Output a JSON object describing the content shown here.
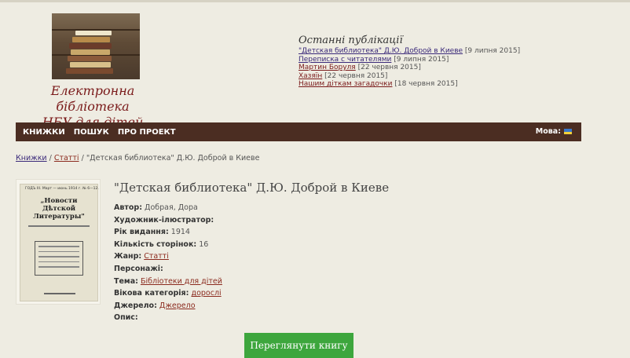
{
  "site": {
    "title_line1": "Електронна бібліотека",
    "title_line2": "НБУ для дітей"
  },
  "recent": {
    "title": "Останні публікації",
    "items": [
      {
        "link": "\"Детская библиотека\" Д.Ю. Доброй в Киеве",
        "date": "[9 липня 2015]"
      },
      {
        "link": "Переписка с читателями",
        "date": "[9 липня 2015]"
      },
      {
        "link": "Мартин Боруля",
        "date": "[22 червня 2015]"
      },
      {
        "link": "Хазяїн",
        "date": "[22 червня 2015]"
      },
      {
        "link": "Нашим діткам загадочки",
        "date": "[18 червня 2015]"
      }
    ]
  },
  "nav": {
    "items": [
      "КНИЖКИ",
      "ПОШУК",
      "ПРО ПРОЕКТ"
    ],
    "lang_label": "Мова:"
  },
  "breadcrumb": {
    "home": "Книжки",
    "sep1": " / ",
    "section": "Статті",
    "sep2": " / ",
    "current": "\"Детская библиотека\" Д.Ю. Доброй в Киеве"
  },
  "cover": {
    "header": "ГОДЪ III.   Март — июнь 1914 г.   № 6—12.",
    "title": "„Новости Дѣтской Литературы\""
  },
  "book": {
    "title": "\"Детская библиотека\" Д.Ю. Доброй в Киеве",
    "fields": [
      {
        "label": "Автор:",
        "value": "Добрая, Дора",
        "link": false
      },
      {
        "label": "Художник-ілюстратор:",
        "value": "",
        "link": false
      },
      {
        "label": "Рік видання:",
        "value": "1914",
        "link": false
      },
      {
        "label": "Кількість сторінок:",
        "value": "16",
        "link": false
      },
      {
        "label": "Жанр:",
        "value": "Статті",
        "link": true
      },
      {
        "label": "Персонажі:",
        "value": "",
        "link": false
      },
      {
        "label": "Тема:",
        "value": "Бібліотеки для дітей",
        "link": true
      },
      {
        "label": "Вікова категорія:",
        "value": "дорослі",
        "link": true
      },
      {
        "label": "Джерело:",
        "value": "Джерело",
        "link": true
      },
      {
        "label": "Опис:",
        "value": "",
        "link": false
      }
    ],
    "view_button": "Переглянути книгу"
  },
  "colors": {
    "page_bg": "#eeece2",
    "nav_bg": "#4b2d22",
    "title_red": "#7a1a1a",
    "button_green": "#3da63d"
  }
}
